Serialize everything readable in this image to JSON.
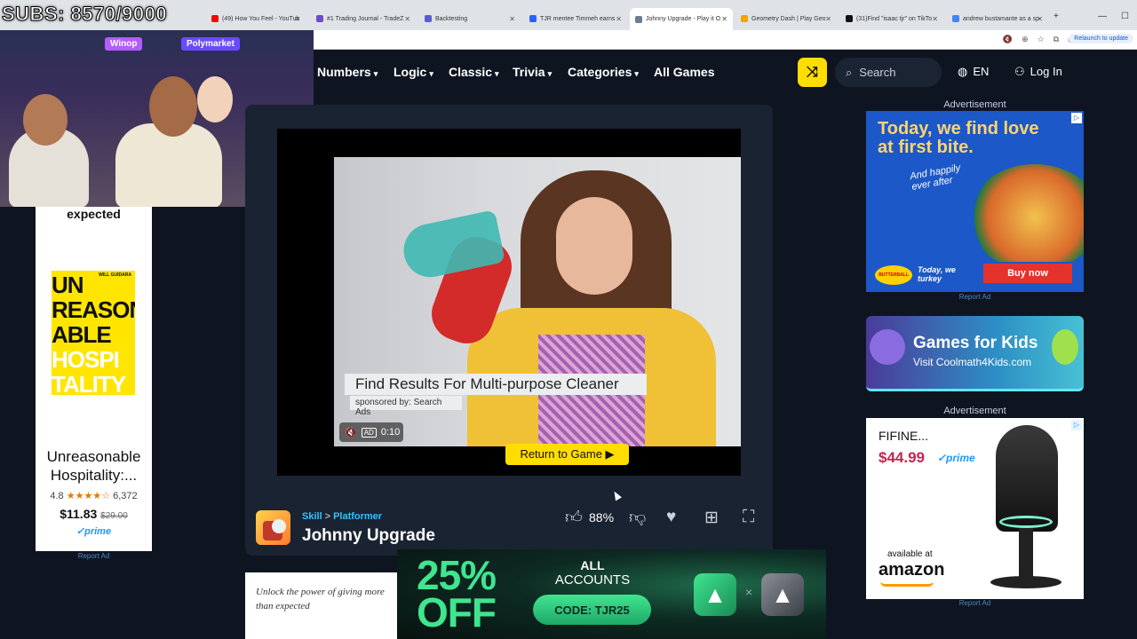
{
  "browser": {
    "tabs": [
      {
        "label": "(49) How You Feel - YouTub",
        "color": "#ff0000"
      },
      {
        "label": "#1 Trading Journal - TradeZ",
        "color": "#6b4cc9"
      },
      {
        "label": "Backtesting",
        "color": "#5b5bd6"
      },
      {
        "label": "TJR mentee Timmeh earns",
        "color": "#2962ff"
      },
      {
        "label": "Johnny Upgrade - Play it O",
        "color": "#6b7c93"
      },
      {
        "label": "Geometry Dash | Play Geo",
        "color": "#f0a500"
      },
      {
        "label": "(31)Find \"isaac tjr\" on TikTo",
        "color": "#111111"
      },
      {
        "label": "andrew bustamante as a sp",
        "color": "#4285f4"
      }
    ],
    "relaunch_label": "Relaunch to update"
  },
  "overlay": {
    "subs_counter": "SUBS: 8570/9000",
    "webcam_signs": [
      "Winop",
      "Polymarket"
    ]
  },
  "nav": {
    "items": [
      {
        "label": "Numbers",
        "dropdown": true
      },
      {
        "label": "Logic",
        "dropdown": true
      },
      {
        "label": "Classic",
        "dropdown": true
      },
      {
        "label": "Trivia",
        "dropdown": true
      },
      {
        "label": "Categories",
        "dropdown": true
      },
      {
        "label": "All Games",
        "dropdown": false
      }
    ],
    "search_placeholder": "Search",
    "language": "EN",
    "login": "Log In"
  },
  "left_ad": {
    "top_text": "expected",
    "book_cover_lines": [
      "UN",
      "REASON",
      "ABLE",
      "HOSPI",
      "TALITY"
    ],
    "book_author": "WILL GUIDARA",
    "book_title": "Unreasonable Hospitality:...",
    "rating": "4.8",
    "stars": "★★★★☆",
    "review_count": "6,372",
    "price": "$11.83",
    "list_price": "$29.00",
    "prime": "✓prime",
    "report": "Report Ad"
  },
  "player": {
    "ad_headline": "Find Results For Multi-purpose Cleaner",
    "sponsored": "sponsored by: Search Ads",
    "ad_badge": "AD",
    "ad_time": "0:10",
    "return_button": "Return to Game ▶"
  },
  "game": {
    "breadcrumb": [
      "Skill",
      "Platformer"
    ],
    "breadcrumb_sep": ">",
    "title": "Johnny Upgrade",
    "like_percent": "88%"
  },
  "right_ads": {
    "label": "Advertisement",
    "ad1": {
      "headline": "Today, we find love at first bite.",
      "subline": "And happily ever after",
      "brand": "BUTTERBALL",
      "tagline": "Today, we turkey",
      "cta": "Buy now"
    },
    "report": "Report Ad",
    "kids": {
      "title": "Games for Kids",
      "subtitle": "Visit Coolmath4Kids.com"
    },
    "ad2": {
      "brand": "FIFINE...",
      "price": "$44.99",
      "prime": "✓prime",
      "available": "available at",
      "store": "amazon"
    }
  },
  "bottom_ad": {
    "text": "Unlock the power of giving more than expected"
  },
  "promo": {
    "percent": "25%",
    "off": "OFF",
    "all": "ALL",
    "accounts": "ACCOUNTS",
    "code": "CODE: TJR25",
    "times": "×"
  }
}
